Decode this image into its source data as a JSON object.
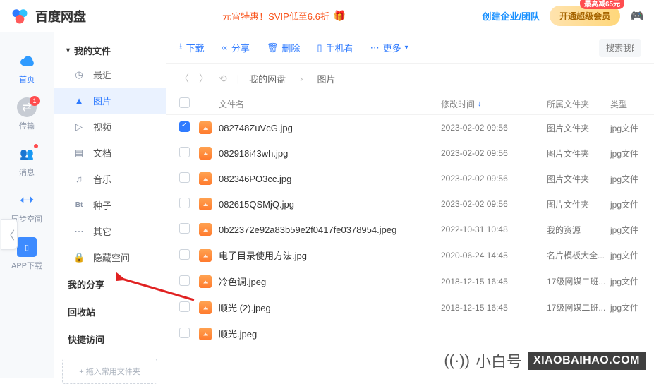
{
  "top": {
    "logo_text": "百度网盘",
    "promo": "元宵特惠！SVIP低至6.6折",
    "create_link": "创建企业/团队",
    "vip_button": "开通超级会员",
    "vip_badge": "最高减65元"
  },
  "sidenav": {
    "items": [
      {
        "label": "首页",
        "icon": "cloud",
        "active": true
      },
      {
        "label": "传输",
        "icon": "swap",
        "badge": "1"
      },
      {
        "label": "消息",
        "icon": "people",
        "dot": true
      },
      {
        "label": "同步空间",
        "icon": "sync"
      },
      {
        "label": "APP下载",
        "icon": "phone"
      }
    ]
  },
  "tree": {
    "header": "我的文件",
    "items": [
      {
        "label": "最近",
        "icon": "clock"
      },
      {
        "label": "图片",
        "icon": "image",
        "selected": true
      },
      {
        "label": "视频",
        "icon": "play"
      },
      {
        "label": "文档",
        "icon": "doc"
      },
      {
        "label": "音乐",
        "icon": "music"
      },
      {
        "label": "种子",
        "icon": "bt"
      },
      {
        "label": "其它",
        "icon": "dots"
      },
      {
        "label": "隐藏空间",
        "icon": "lock"
      }
    ],
    "sections": [
      "我的分享",
      "回收站",
      "快捷访问"
    ],
    "drop": "+ 拖入常用文件夹"
  },
  "toolbar": {
    "download": "下载",
    "share": "分享",
    "delete": "删除",
    "mobile": "手机看",
    "more": "更多"
  },
  "search": {
    "placeholder": "搜索我的网"
  },
  "breadcrumb": {
    "root": "我的网盘",
    "current": "图片"
  },
  "columns": {
    "name": "文件名",
    "time": "修改时间",
    "folder": "所属文件夹",
    "type": "类型"
  },
  "files": [
    {
      "name": "082748ZuVcG.jpg",
      "time": "2023-02-02 09:56",
      "folder": "图片文件夹",
      "type": "jpg文件",
      "checked": true
    },
    {
      "name": "082918i43wh.jpg",
      "time": "2023-02-02 09:56",
      "folder": "图片文件夹",
      "type": "jpg文件"
    },
    {
      "name": "082346PO3cc.jpg",
      "time": "2023-02-02 09:56",
      "folder": "图片文件夹",
      "type": "jpg文件"
    },
    {
      "name": "082615QSMjQ.jpg",
      "time": "2023-02-02 09:56",
      "folder": "图片文件夹",
      "type": "jpg文件"
    },
    {
      "name": "0b22372e92a83b59e2f0417fe0378954.jpeg",
      "time": "2022-10-31 10:48",
      "folder": "我的资源",
      "type": "jpg文件"
    },
    {
      "name": "电子目录使用方法.jpg",
      "time": "2020-06-24 14:45",
      "folder": "名片模板大全...",
      "type": "jpg文件"
    },
    {
      "name": "冷色调.jpeg",
      "time": "2018-12-15 16:45",
      "folder": "17级网媒二班...",
      "type": "jpg文件"
    },
    {
      "name": "顺光 (2).jpeg",
      "time": "2018-12-15 16:45",
      "folder": "17级网媒二班...",
      "type": "jpg文件"
    },
    {
      "name": "顺光.jpeg",
      "time": "",
      "folder": "",
      "type": ""
    }
  ],
  "watermark": {
    "text": "小白号",
    "url": "XIAOBAIHAO.COM"
  }
}
